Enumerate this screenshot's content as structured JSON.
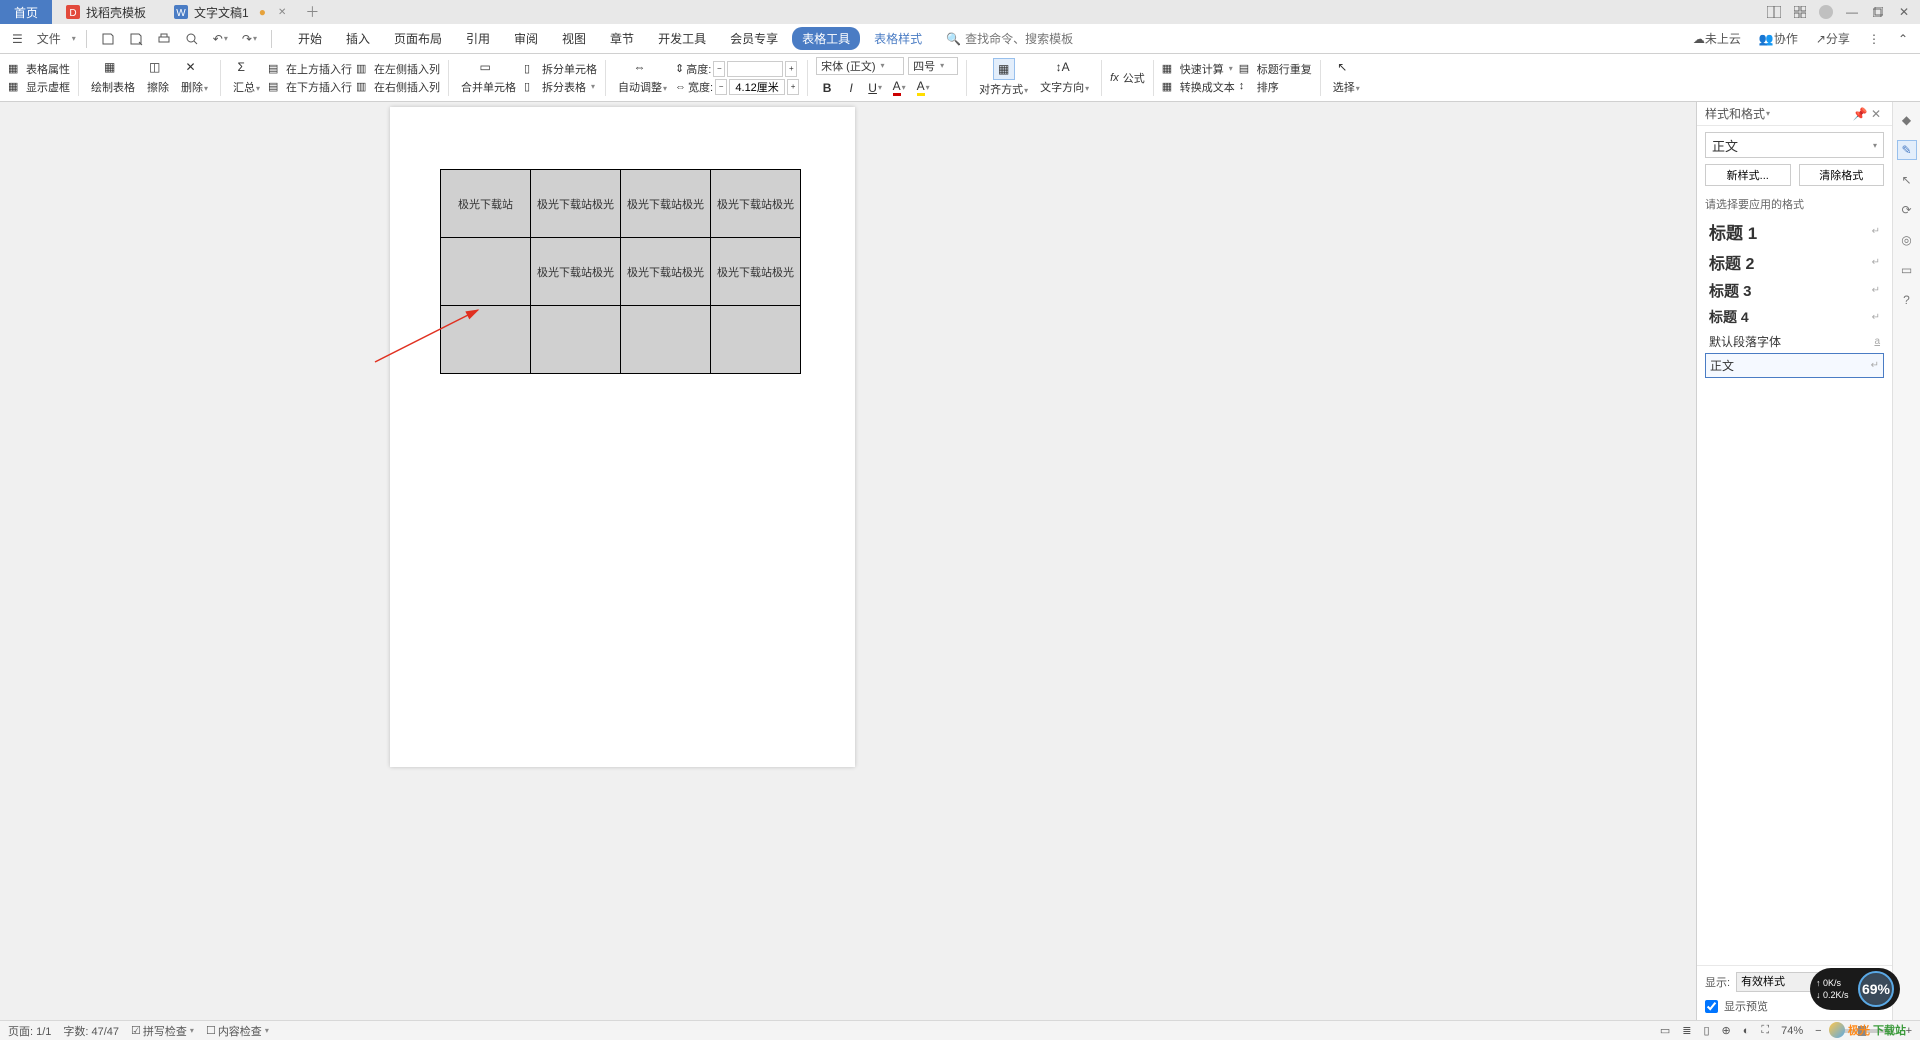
{
  "tabs": {
    "home": "首页",
    "template": "找稻壳模板",
    "doc": "文字文稿1"
  },
  "menu": {
    "file": "文件",
    "items": [
      "开始",
      "插入",
      "页面布局",
      "引用",
      "审阅",
      "视图",
      "章节",
      "开发工具",
      "会员专享"
    ],
    "tableTools": "表格工具",
    "tableStyle": "表格样式",
    "search_placeholder": "查找命令、搜索模板",
    "cloud": "未上云",
    "collab": "协作",
    "share": "分享"
  },
  "ribbon": {
    "tableProps": "表格属性",
    "showGrid": "显示虚框",
    "drawTable": "绘制表格",
    "eraser": "擦除",
    "delete": "删除",
    "summary": "汇总",
    "insertAbove": "在上方插入行",
    "insertBelow": "在下方插入行",
    "insertLeft": "在左侧插入列",
    "insertRight": "在右侧插入列",
    "mergeCells": "合并单元格",
    "splitCell": "拆分单元格",
    "splitTable": "拆分表格",
    "autoFit": "自动调整",
    "heightLabel": "高度:",
    "widthLabel": "宽度:",
    "width_value": "4.12厘米",
    "font": "宋体 (正文)",
    "fontSize": "四号",
    "align": "对齐方式",
    "textDir": "文字方向",
    "formula": "公式",
    "quickCalc": "快速计算",
    "repeatHeader": "标题行重复",
    "toText": "转换成文本",
    "sort": "排序",
    "select": "选择"
  },
  "table": {
    "r1": [
      "极光下载站",
      "极光下载站极光",
      "极光下载站极光",
      "极光下载站极光"
    ],
    "r2": [
      "",
      "极光下载站极光",
      "极光下载站极光",
      "极光下载站极光"
    ],
    "r3": [
      "",
      "",
      "",
      ""
    ]
  },
  "panel": {
    "title": "样式和格式",
    "current": "正文",
    "newStyle": "新样式...",
    "clearFmt": "清除格式",
    "hint": "请选择要应用的格式",
    "h1": "标题 1",
    "h2": "标题 2",
    "h3": "标题 3",
    "h4": "标题 4",
    "defPara": "默认段落字体",
    "bodyText": "正文",
    "showLabel": "显示:",
    "showValue": "有效样式",
    "preview": "显示预览"
  },
  "status": {
    "page": "页面: 1/1",
    "words": "字数: 47/47",
    "spell": "拼写检查",
    "content": "内容检查",
    "zoom": "74%"
  },
  "gauge": {
    "up": "0K/s",
    "down": "0.2K/s",
    "pct": "69%"
  },
  "watermark": {
    "a": "极光",
    "b": "下载站"
  }
}
